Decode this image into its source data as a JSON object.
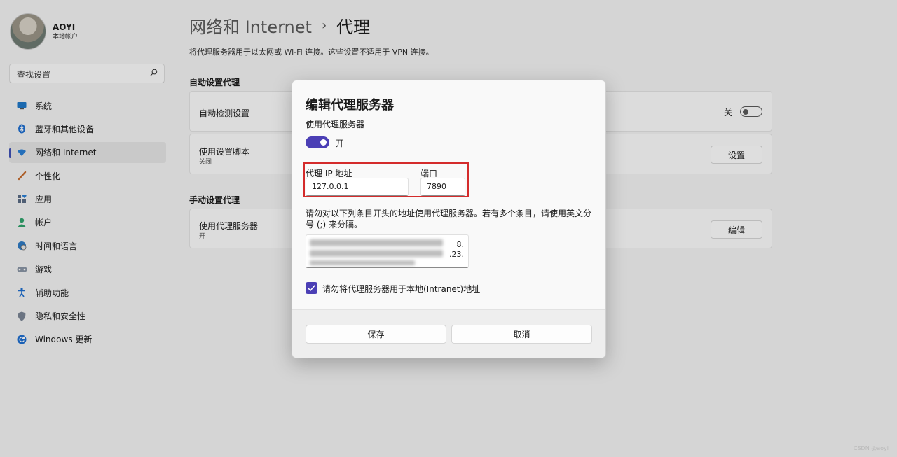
{
  "profile": {
    "name": "AOYI",
    "account_type": "本地帐户"
  },
  "search": {
    "placeholder": "查找设置"
  },
  "sidebar": {
    "items": [
      {
        "label": "系统",
        "icon": "monitor-icon"
      },
      {
        "label": "蓝牙和其他设备",
        "icon": "bluetooth-icon"
      },
      {
        "label": "网络和 Internet",
        "icon": "wifi-icon",
        "active": true
      },
      {
        "label": "个性化",
        "icon": "brush-icon"
      },
      {
        "label": "应用",
        "icon": "apps-icon"
      },
      {
        "label": "帐户",
        "icon": "person-icon"
      },
      {
        "label": "时间和语言",
        "icon": "globe-clock-icon"
      },
      {
        "label": "游戏",
        "icon": "gamepad-icon"
      },
      {
        "label": "辅助功能",
        "icon": "accessibility-icon"
      },
      {
        "label": "隐私和安全性",
        "icon": "shield-icon"
      },
      {
        "label": "Windows 更新",
        "icon": "update-icon"
      }
    ]
  },
  "header": {
    "parent": "网络和 Internet",
    "current": "代理",
    "description": "将代理服务器用于以太网或 Wi-Fi 连接。这些设置不适用于 VPN 连接。"
  },
  "auto_section": {
    "title": "自动设置代理",
    "detect": {
      "label": "自动检测设置",
      "state_label": "关"
    },
    "script": {
      "label": "使用设置脚本",
      "sub": "关闭",
      "button": "设置"
    }
  },
  "manual_section": {
    "title": "手动设置代理",
    "proxy": {
      "label": "使用代理服务器",
      "sub": "开",
      "button": "编辑"
    }
  },
  "dialog": {
    "title": "编辑代理服务器",
    "use_proxy_label": "使用代理服务器",
    "toggle_state": "开",
    "ip_label": "代理 IP 地址",
    "ip_value": "127.0.0.1",
    "port_label": "端口",
    "port_value": "7890",
    "exclusion_note": "请勿对以下列条目开头的地址使用代理服务器。若有多个条目，请使用英文分号 (;) 来分隔。",
    "exclusions_fragment_1": "8.",
    "exclusions_fragment_2": ".23.",
    "local_checkbox_label": "请勿将代理服务器用于本地(Intranet)地址",
    "local_checkbox_checked": true,
    "save_label": "保存",
    "cancel_label": "取消"
  },
  "watermark": "CSDN @aoyi",
  "colors": {
    "accent": "#4b3fb5",
    "highlight_border": "#d42b2b"
  }
}
